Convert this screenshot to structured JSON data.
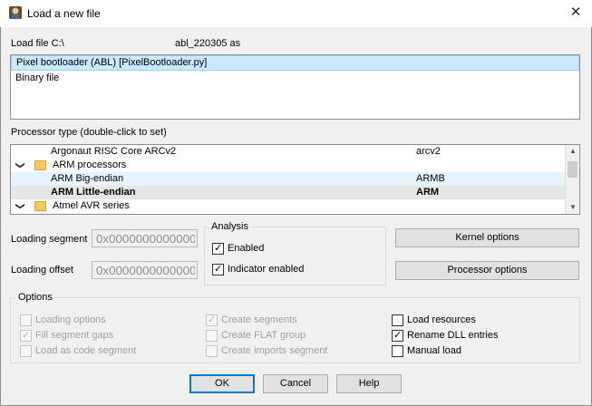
{
  "window": {
    "title": "Load a new file",
    "close_glyph": "✕"
  },
  "load_file": {
    "label": "Load file C:\\",
    "filename": "abl_220305 as"
  },
  "loader_list": [
    {
      "label": "Pixel bootloader (ABL) [PixelBootloader.py]",
      "selected": true
    },
    {
      "label": "Binary file",
      "selected": false
    }
  ],
  "processor": {
    "label": "Processor type (double-click to set)",
    "rows": [
      {
        "name": "Argonaut RISC Core ARCv2",
        "code": "arcv2",
        "kind": "item"
      },
      {
        "name": "ARM processors",
        "code": "",
        "kind": "folder",
        "expanded": true
      },
      {
        "name": "ARM Big-endian",
        "code": "ARMB",
        "kind": "item"
      },
      {
        "name": "ARM Little-endian",
        "code": "ARM",
        "kind": "item",
        "selected": true
      },
      {
        "name": "Atmel AVR series",
        "code": "",
        "kind": "folder",
        "expanded": true
      }
    ],
    "scroll_up_glyph": "▲",
    "scroll_down_glyph": "▼"
  },
  "loading_segment": {
    "label": "Loading segment",
    "value": "0x0000000000000000"
  },
  "loading_offset": {
    "label": "Loading offset",
    "value": "0x0000000000000000"
  },
  "analysis": {
    "title": "Analysis",
    "enabled": {
      "label": "Enabled",
      "checked": true
    },
    "indicator": {
      "label": "Indicator enabled",
      "checked": true
    }
  },
  "buttons": {
    "kernel_options": "Kernel options",
    "processor_options": "Processor options",
    "ok": "OK",
    "cancel": "Cancel",
    "help": "Help"
  },
  "options": {
    "title": "Options",
    "col1": [
      {
        "label": "Loading options",
        "checked": false,
        "disabled": true
      },
      {
        "label": "Fill segment gaps",
        "checked": true,
        "disabled": true
      },
      {
        "label": "Load as code segment",
        "checked": false,
        "disabled": true
      }
    ],
    "col2": [
      {
        "label": "Create segments",
        "checked": true,
        "disabled": true
      },
      {
        "label": "Create FLAT group",
        "checked": false,
        "disabled": true
      },
      {
        "label": "Create imports segment",
        "checked": false,
        "disabled": true
      }
    ],
    "col3": [
      {
        "label": "Load resources",
        "checked": false,
        "disabled": false
      },
      {
        "label": "Rename DLL entries",
        "checked": true,
        "disabled": false
      },
      {
        "label": "Manual load",
        "checked": false,
        "disabled": false
      }
    ]
  },
  "check_glyph": "✓",
  "chevron_glyph": "❯"
}
